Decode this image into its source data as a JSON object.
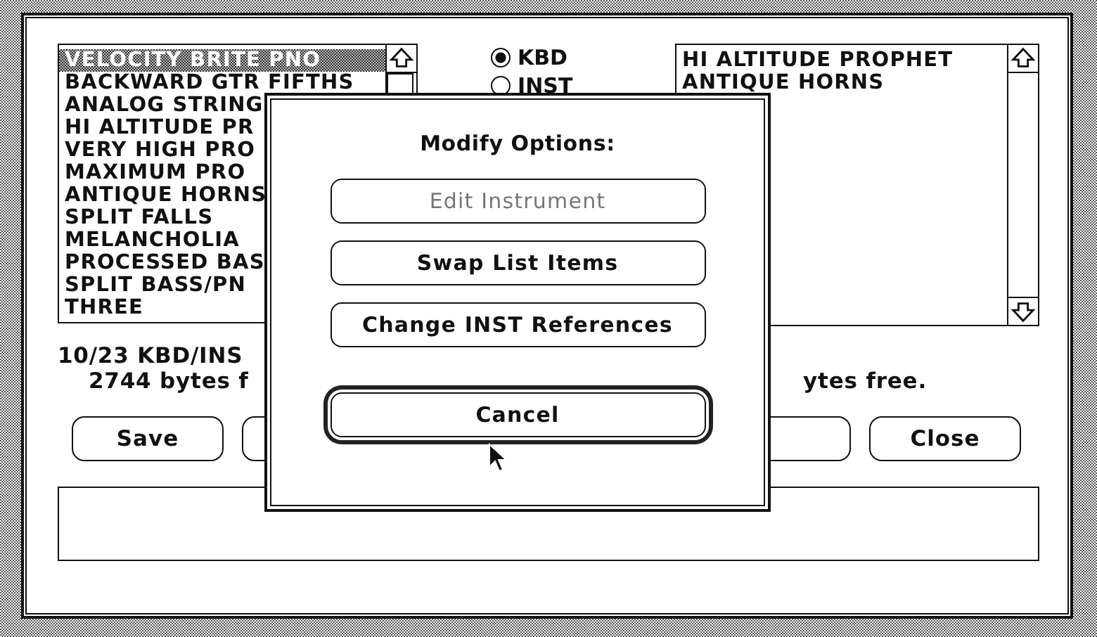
{
  "left_list": {
    "items": [
      {
        "label": "VELOCITY BRITE PNO",
        "selected": true
      },
      {
        "label": "BACKWARD GTR FIFTHS",
        "selected": false
      },
      {
        "label": "ANALOG STRING",
        "selected": false
      },
      {
        "label": "HI ALTITUDE PR",
        "selected": false
      },
      {
        "label": "VERY HIGH PRO",
        "selected": false
      },
      {
        "label": "MAXIMUM PRO",
        "selected": false
      },
      {
        "label": "ANTIQUE HORNS",
        "selected": false
      },
      {
        "label": "SPLIT FALLS",
        "selected": false
      },
      {
        "label": "MELANCHOLIA",
        "selected": false
      },
      {
        "label": "PROCESSED BAS",
        "selected": false
      },
      {
        "label": "SPLIT BASS/PN",
        "selected": false
      },
      {
        "label": "THREE",
        "selected": false
      }
    ]
  },
  "radios": [
    {
      "label": "KBD",
      "selected": true
    },
    {
      "label": "INST",
      "selected": false
    }
  ],
  "right_list": {
    "items": [
      "HI ALTITUDE PROPHET",
      "ANTIQUE HORNS"
    ]
  },
  "status": {
    "left_lines": [
      "10/23 KBD/INS",
      "2744 bytes f"
    ],
    "right": "ytes free."
  },
  "buttons": [
    {
      "kind": "labeled",
      "label": "Save"
    },
    {
      "kind": "covered"
    },
    {
      "kind": "covered"
    },
    {
      "kind": "labeled",
      "label": "Close"
    }
  ],
  "modal": {
    "title": "Modify Options:",
    "buttons": [
      {
        "label": "Edit Instrument",
        "disabled": true,
        "default": false
      },
      {
        "label": "Swap List Items",
        "disabled": false,
        "default": false
      },
      {
        "label": "Change INST References",
        "disabled": false,
        "default": false
      },
      {
        "label": "Cancel",
        "disabled": false,
        "default": true
      }
    ]
  }
}
